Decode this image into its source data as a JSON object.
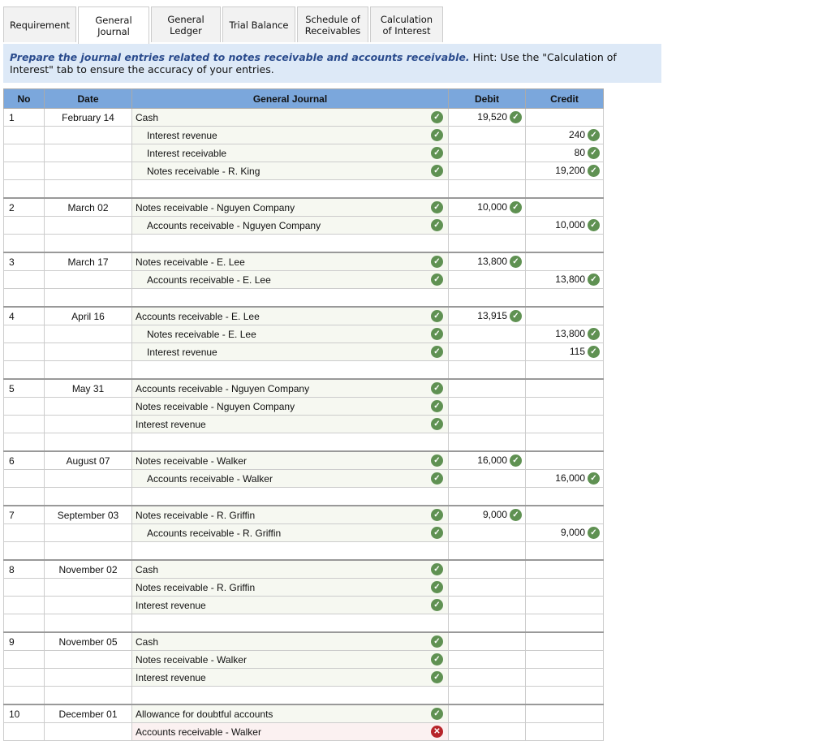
{
  "tabs": [
    {
      "label": "Requirement",
      "active": false
    },
    {
      "label": "General Journal",
      "active": true
    },
    {
      "label": "General Ledger",
      "active": false
    },
    {
      "label": "Trial Balance",
      "active": false
    },
    {
      "label": "Schedule of Receivables",
      "active": false
    },
    {
      "label": "Calculation of Interest",
      "active": false
    }
  ],
  "instructions": {
    "bold": "Prepare the journal entries related to notes receivable and accounts receivable.",
    "hint": " Hint:  Use the \"Calculation of Interest\" tab to ensure the accuracy of your entries."
  },
  "table": {
    "headers": {
      "no": "No",
      "date": "Date",
      "journal": "General Journal",
      "debit": "Debit",
      "credit": "Credit"
    },
    "entries": [
      {
        "no": "1",
        "date": "February 14",
        "lines": [
          {
            "account": "Cash",
            "indent": false,
            "debit": "19,520",
            "credit": "",
            "status": "correct"
          },
          {
            "account": "Interest revenue",
            "indent": true,
            "debit": "",
            "credit": "240",
            "status": "correct"
          },
          {
            "account": "Interest receivable",
            "indent": true,
            "debit": "",
            "credit": "80",
            "status": "correct"
          },
          {
            "account": "Notes receivable - R. King",
            "indent": true,
            "debit": "",
            "credit": "19,200",
            "status": "correct"
          }
        ]
      },
      {
        "no": "2",
        "date": "March 02",
        "lines": [
          {
            "account": "Notes receivable - Nguyen Company",
            "indent": false,
            "debit": "10,000",
            "credit": "",
            "status": "correct"
          },
          {
            "account": "Accounts receivable - Nguyen Company",
            "indent": true,
            "debit": "",
            "credit": "10,000",
            "status": "correct"
          }
        ]
      },
      {
        "no": "3",
        "date": "March 17",
        "lines": [
          {
            "account": "Notes receivable - E. Lee",
            "indent": false,
            "debit": "13,800",
            "credit": "",
            "status": "correct"
          },
          {
            "account": "Accounts receivable - E. Lee",
            "indent": true,
            "debit": "",
            "credit": "13,800",
            "status": "correct"
          }
        ]
      },
      {
        "no": "4",
        "date": "April 16",
        "lines": [
          {
            "account": "Accounts receivable - E. Lee",
            "indent": false,
            "debit": "13,915",
            "credit": "",
            "status": "correct"
          },
          {
            "account": "Notes receivable - E. Lee",
            "indent": true,
            "debit": "",
            "credit": "13,800",
            "status": "correct"
          },
          {
            "account": "Interest revenue",
            "indent": true,
            "debit": "",
            "credit": "115",
            "status": "correct"
          }
        ]
      },
      {
        "no": "5",
        "date": "May 31",
        "lines": [
          {
            "account": "Accounts receivable - Nguyen Company",
            "indent": false,
            "debit": "",
            "credit": "",
            "status": "correct"
          },
          {
            "account": "Notes receivable - Nguyen Company",
            "indent": false,
            "debit": "",
            "credit": "",
            "status": "correct"
          },
          {
            "account": "Interest revenue",
            "indent": false,
            "debit": "",
            "credit": "",
            "status": "correct"
          }
        ]
      },
      {
        "no": "6",
        "date": "August 07",
        "lines": [
          {
            "account": "Notes receivable - Walker",
            "indent": false,
            "debit": "16,000",
            "credit": "",
            "status": "correct"
          },
          {
            "account": "Accounts receivable - Walker",
            "indent": true,
            "debit": "",
            "credit": "16,000",
            "status": "correct"
          }
        ]
      },
      {
        "no": "7",
        "date": "September 03",
        "lines": [
          {
            "account": "Notes receivable - R. Griffin",
            "indent": false,
            "debit": "9,000",
            "credit": "",
            "status": "correct"
          },
          {
            "account": "Accounts receivable - R. Griffin",
            "indent": true,
            "debit": "",
            "credit": "9,000",
            "status": "correct"
          }
        ]
      },
      {
        "no": "8",
        "date": "November 02",
        "lines": [
          {
            "account": "Cash",
            "indent": false,
            "debit": "",
            "credit": "",
            "status": "correct"
          },
          {
            "account": "Notes receivable - R. Griffin",
            "indent": false,
            "debit": "",
            "credit": "",
            "status": "correct"
          },
          {
            "account": "Interest revenue",
            "indent": false,
            "debit": "",
            "credit": "",
            "status": "correct"
          }
        ]
      },
      {
        "no": "9",
        "date": "November 05",
        "lines": [
          {
            "account": "Cash",
            "indent": false,
            "debit": "",
            "credit": "",
            "status": "correct"
          },
          {
            "account": "Notes receivable - Walker",
            "indent": false,
            "debit": "",
            "credit": "",
            "status": "correct"
          },
          {
            "account": "Interest revenue",
            "indent": false,
            "debit": "",
            "credit": "",
            "status": "correct"
          }
        ]
      },
      {
        "no": "10",
        "date": "December 01",
        "lines": [
          {
            "account": "Allowance for doubtful accounts",
            "indent": false,
            "debit": "",
            "credit": "",
            "status": "correct"
          },
          {
            "account": "Accounts receivable - Walker",
            "indent": false,
            "debit": "",
            "credit": "",
            "status": "incorrect"
          }
        ]
      }
    ]
  },
  "colors": {
    "header": "#7ba7dc",
    "banner": "#dde9f7",
    "correct": "#5f9152",
    "incorrect": "#b7252a"
  }
}
